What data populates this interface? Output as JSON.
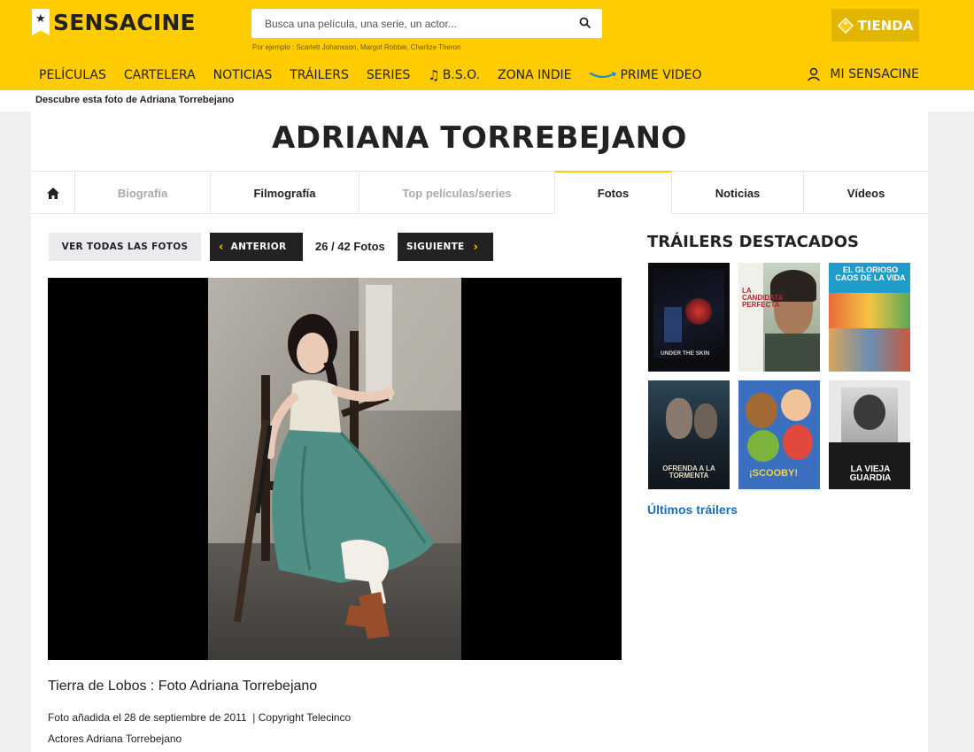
{
  "brand": {
    "name": "SENSACINE"
  },
  "search": {
    "placeholder": "Busca una película, una serie, un actor...",
    "hint": "Por ejemplo : Scarlett Johansson, Margot Robbie, Charlize Theron"
  },
  "shop": {
    "label": "TIENDA"
  },
  "nav": {
    "items": [
      "PELÍCULAS",
      "CARTELERA",
      "NOTICIAS",
      "TRÁILERS",
      "SERIES",
      "B.S.O.",
      "ZONA INDIE",
      "PRIME VIDEO"
    ],
    "account_label": "MI SENSACINE"
  },
  "breadcrumb": "Descubre esta foto de Adriana Torrebejano",
  "page_title": "ADRIANA TORREBEJANO",
  "tabs": [
    {
      "label": "Biografía",
      "state": "dim"
    },
    {
      "label": "Filmografía",
      "state": "normal"
    },
    {
      "label": "Top películas/series",
      "state": "dim"
    },
    {
      "label": "Fotos",
      "state": "active"
    },
    {
      "label": "Noticias",
      "state": "normal"
    },
    {
      "label": "Vídeos",
      "state": "normal"
    }
  ],
  "toolbar": {
    "all_photos_label": "VER TODAS LAS FOTOS",
    "prev_label": "ANTERIOR",
    "counter": "26 / 42 Fotos",
    "next_label": "SIGUIENTE"
  },
  "photo": {
    "title": "Tierra de Lobos : Foto Adriana Torrebejano",
    "meta": "Foto añadida el 28 de septiembre de 2011  | Copyright Telecinco",
    "actors_label": "Actores",
    "actor_name": "Adriana Torrebejano"
  },
  "sidebar": {
    "title": "TRÁILERS DESTACADOS",
    "posters": [
      {
        "title": "UNDER THE SKIN",
        "name": "under-the-skin-poster"
      },
      {
        "title": "LA CANDIDATA PERFECTA",
        "name": "la-candidata-perfecta-poster"
      },
      {
        "title": "EL GLORIOSO CAOS DE LA VIDA",
        "name": "el-glorioso-caos-poster"
      },
      {
        "title": "OFRENDA A LA TORMENTA",
        "name": "ofrenda-tormenta-poster"
      },
      {
        "title": "¡SCOOBY!",
        "name": "scooby-poster"
      },
      {
        "title": "LA VIEJA GUARDIA",
        "name": "la-vieja-guardia-poster"
      }
    ],
    "more_link": "Últimos tráilers"
  },
  "colors": {
    "brand_yellow": "#fecc00",
    "link_blue": "#1a6fb8",
    "dark_button": "#222222"
  }
}
